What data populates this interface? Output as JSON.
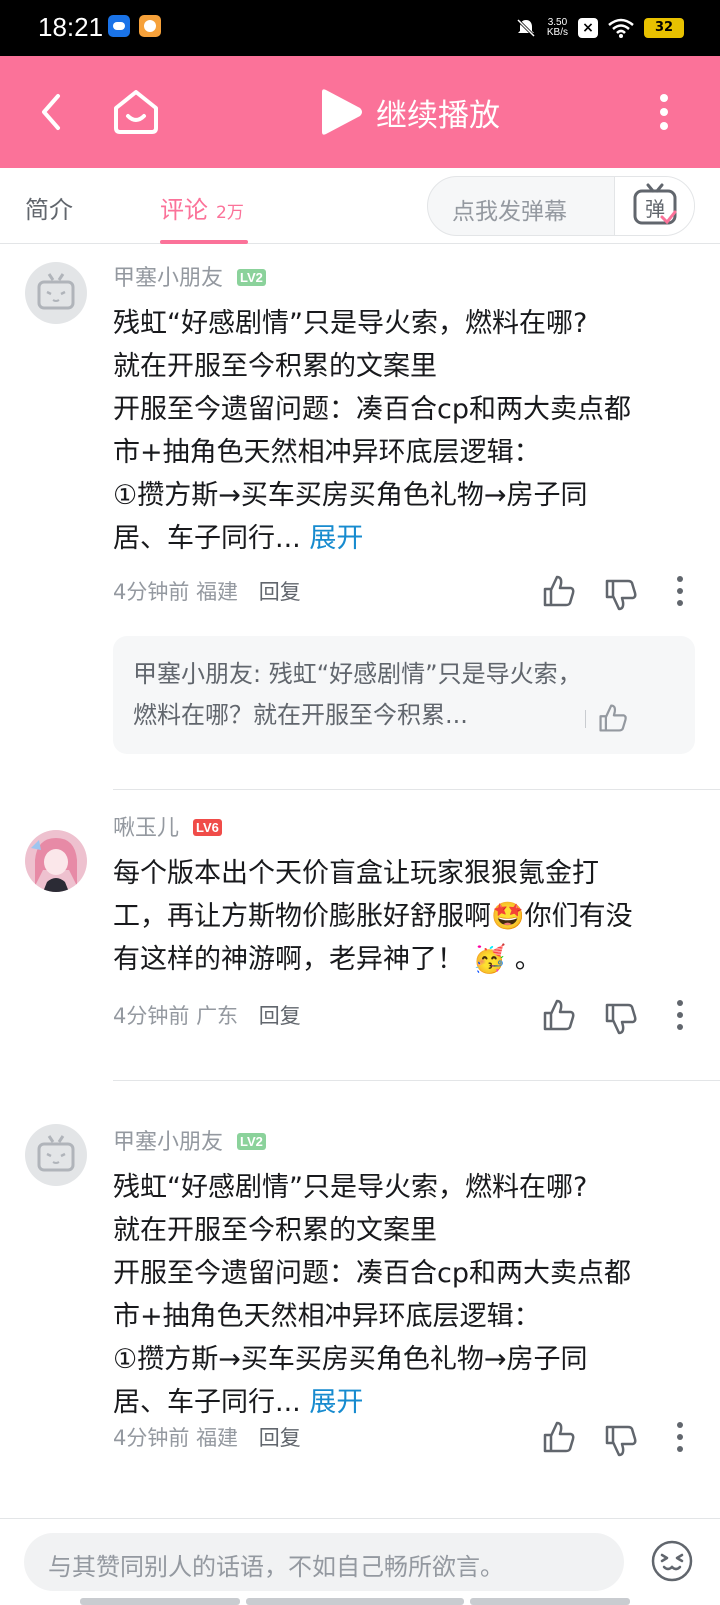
{
  "status_bar": {
    "time": "18:21",
    "net_speed_value": "3.50",
    "net_speed_unit": "KB/s",
    "battery": "32"
  },
  "header": {
    "title": "继续播放"
  },
  "tabs": {
    "intro": "简介",
    "comments": "评论",
    "comments_count": "2万",
    "danmaku_placeholder": "点我发弹幕",
    "danmaku_button_glyph": "弹"
  },
  "comments": [
    {
      "username": "甲塞小朋友",
      "level": "LV2",
      "lines": [
        "残虹“好感剧情”只是导火索，燃料在哪?",
        "就在开服至今积累的文案里",
        "开服至今遗留问题：凑百合cp和两大卖点都",
        "市+抽角色天然相冲异环底层逻辑：",
        "①攒方斯→买车买房买角色礼物→房子同"
      ],
      "last_line": "居、车子同行...",
      "expand": "展开",
      "time": "4分钟前",
      "location": "福建",
      "reply": "回复",
      "subreply": "甲塞小朋友: 残虹“好感剧情”只是导火索，燃料在哪？就在开服至今积累..."
    },
    {
      "username": "啾玉儿",
      "level": "LV6",
      "lines": [
        "每个版本出个天价盲盒让玩家狠狠氪金打",
        "工，再让方斯物价膨胀好舒服啊🤩你们有没",
        "有这样的神游啊，老异神了！ 🥳 。"
      ],
      "time": "4分钟前",
      "location": "广东",
      "reply": "回复"
    },
    {
      "username": "甲塞小朋友",
      "level": "LV2",
      "lines": [
        "残虹“好感剧情”只是导火索，燃料在哪?",
        "就在开服至今积累的文案里",
        "开服至今遗留问题：凑百合cp和两大卖点都",
        "市+抽角色天然相冲异环底层逻辑：",
        "①攒方斯→买车买房买角色礼物→房子同"
      ],
      "last_line": "居、车子同行...",
      "expand": "展开",
      "time": "4分钟前",
      "location": "福建",
      "reply": "回复"
    }
  ],
  "bottom": {
    "input_placeholder": "与其赞同别人的话语，不如自己畅所欲言。"
  },
  "colors": {
    "brand_pink": "#fb7299",
    "link_blue": "#178bcf",
    "level2": "#8bd29b",
    "level6": "#f04c49"
  }
}
